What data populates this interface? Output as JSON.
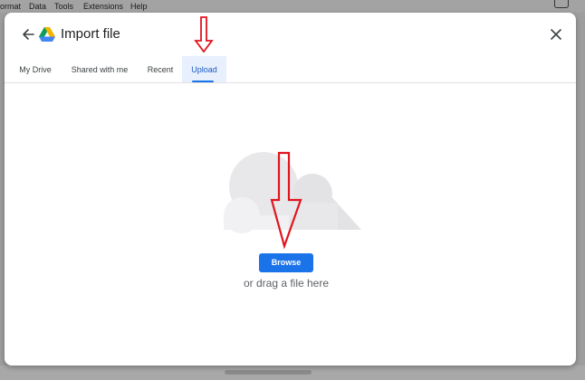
{
  "background_menu": {
    "items": [
      "ormat",
      "Data",
      "Tools",
      "Extensions",
      "Help"
    ]
  },
  "dialog": {
    "title": "Import file",
    "tabs": [
      {
        "label": "My Drive",
        "active": false
      },
      {
        "label": "Shared with me",
        "active": false
      },
      {
        "label": "Recent",
        "active": false
      },
      {
        "label": "Upload",
        "active": true
      }
    ],
    "browse_label": "Browse",
    "drag_text": "or drag a file here"
  },
  "icons": {
    "back": "arrow-back-icon",
    "logo": "google-drive-logo",
    "close": "close-icon",
    "cloud": "cloud-illustration",
    "annotation": "red-down-arrow"
  },
  "colors": {
    "accent": "#1a73e8",
    "active_tab_bg": "#e8f0fe",
    "annotation": "#e0141e",
    "cloud": "#e3e3e6"
  }
}
